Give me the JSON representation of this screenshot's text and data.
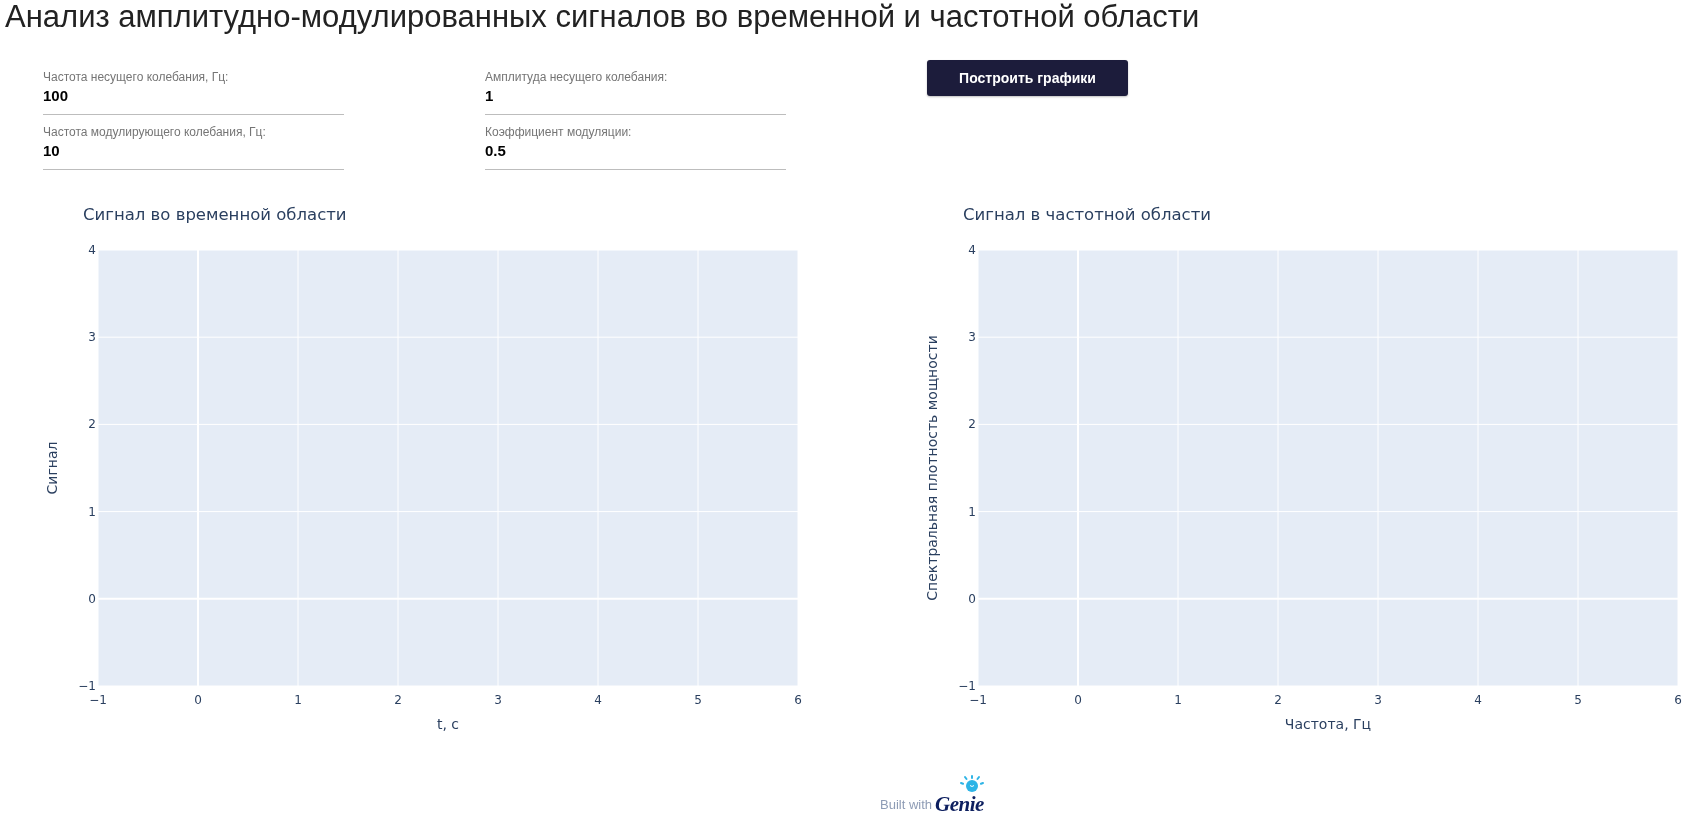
{
  "title": "Анализ амплитудно-модулированных сигналов во временной и частотной области",
  "fields": [
    {
      "label": "Частота несущего колебания, Гц:",
      "value": "100"
    },
    {
      "label": "Амплитуда несущего колебания:",
      "value": "1"
    },
    {
      "label": "Частота модулирующего колебания, Гц:",
      "value": "10"
    },
    {
      "label": "Коэффициент модуляции:",
      "value": "0.5"
    }
  ],
  "button": {
    "label": "Построить графики"
  },
  "charts": [
    {
      "chart_data": {
        "type": "line",
        "title": "Сигнал во временной области",
        "xlabel": "t, с",
        "ylabel": "Сигнал",
        "xlim": [
          -1,
          6
        ],
        "ylim": [
          -1,
          4
        ],
        "xticks": [
          {
            "value": -1,
            "label": "−1"
          },
          0,
          1,
          2,
          3,
          4,
          5,
          6
        ],
        "yticks": [
          {
            "value": -1,
            "label": "−1"
          },
          0,
          1,
          2,
          3,
          4
        ],
        "grid": true
      }
    },
    {
      "chart_data": {
        "type": "line",
        "title": "Сигнал в частотной области",
        "xlabel": "Частота, Гц",
        "ylabel": "Спектральная плотность мощности",
        "xlim": [
          -1,
          6
        ],
        "ylim": [
          -1,
          4
        ],
        "xticks": [
          {
            "value": -1,
            "label": "−1"
          },
          0,
          1,
          2,
          3,
          4,
          5,
          6
        ],
        "yticks": [
          {
            "value": -1,
            "label": "−1"
          },
          0,
          1,
          2,
          3,
          4
        ],
        "grid": true
      }
    }
  ],
  "footer": {
    "text": "Built with",
    "logo": "Genie"
  }
}
